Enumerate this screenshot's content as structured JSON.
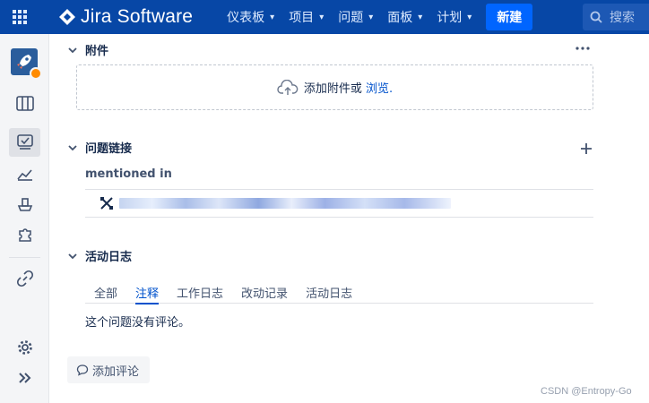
{
  "topnav": {
    "brand": "Jira Software",
    "items": [
      {
        "label": "仪表板"
      },
      {
        "label": "项目"
      },
      {
        "label": "问题"
      },
      {
        "label": "面板"
      },
      {
        "label": "计划"
      }
    ],
    "create_label": "新建",
    "search_placeholder": "搜索",
    "colors": {
      "background": "#0747a6",
      "create": "#0065ff"
    }
  },
  "sidebar": {
    "icons": [
      "project-avatar",
      "board-icon",
      "issues-icon",
      "reports-icon",
      "releases-icon",
      "components-icon",
      "link-icon",
      "settings-icon",
      "expand-icon"
    ],
    "active": "issues-icon"
  },
  "attachments": {
    "title": "附件",
    "drop_text": "添加附件或",
    "browse_label": "浏览."
  },
  "issue_links": {
    "title": "问题链接",
    "link_type": "mentioned in"
  },
  "activity": {
    "title": "活动日志",
    "tabs": [
      {
        "label": "全部"
      },
      {
        "label": "注释"
      },
      {
        "label": "工作日志"
      },
      {
        "label": "改动记录"
      },
      {
        "label": "活动日志"
      }
    ],
    "active_tab": "注释",
    "empty_text": "这个问题没有评论。",
    "add_comment_label": "添加评论"
  },
  "watermark": "CSDN @Entropy-Go"
}
